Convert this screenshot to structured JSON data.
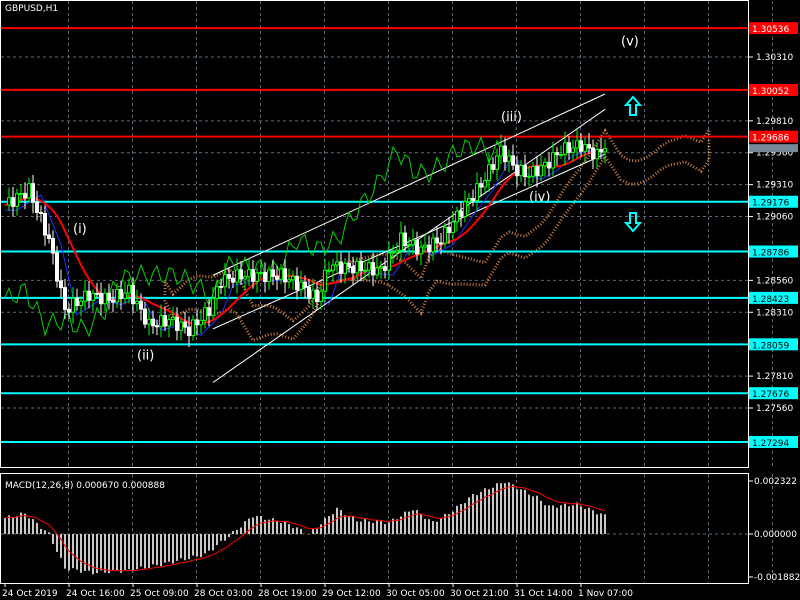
{
  "symbol_label": "GBPUSD,H1",
  "colors": {
    "bull": "#00ff00",
    "bear": "#ffffff",
    "red": "#ff0000",
    "cyan": "#00ffff",
    "grid": "#5a6a7a",
    "cloud": "#ff9a40"
  },
  "chart_data": {
    "type": "candlestick",
    "price_ticks": [
      "1.30310",
      "1.29810",
      "1.29560",
      "1.29310",
      "1.29060",
      "1.28560",
      "1.28310",
      "1.27810",
      "1.27560"
    ],
    "red_levels": [
      "1.30536",
      "1.30052",
      "1.29686"
    ],
    "cyan_levels": [
      "1.29176",
      "1.28786",
      "1.28423",
      "1.28059",
      "1.27676",
      "1.27294"
    ],
    "current_price": "1.29635",
    "price_keypoints": [
      [
        0,
        1.2915
      ],
      [
        6,
        1.2927
      ],
      [
        11,
        1.2888
      ],
      [
        15,
        1.2833
      ],
      [
        21,
        1.2845
      ],
      [
        26,
        1.2841
      ],
      [
        31,
        1.2848
      ],
      [
        36,
        1.2821
      ],
      [
        41,
        1.2825
      ],
      [
        46,
        1.2817
      ],
      [
        51,
        1.2833
      ],
      [
        54,
        1.2856
      ],
      [
        59,
        1.286
      ],
      [
        64,
        1.286
      ],
      [
        69,
        1.286
      ],
      [
        74,
        1.2852
      ],
      [
        78,
        1.2841
      ],
      [
        81,
        1.2868
      ],
      [
        85,
        1.2866
      ],
      [
        89,
        1.2866
      ],
      [
        94,
        1.2864
      ],
      [
        99,
        1.2888
      ],
      [
        104,
        1.288
      ],
      [
        109,
        1.2888
      ],
      [
        114,
        1.2911
      ],
      [
        119,
        1.2931
      ],
      [
        124,
        1.2958
      ],
      [
        128,
        1.2942
      ],
      [
        131,
        1.2939
      ],
      [
        135,
        1.2946
      ],
      [
        139,
        1.2958
      ],
      [
        144,
        1.2962
      ],
      [
        148,
        1.2954
      ],
      [
        150,
        1.2962
      ]
    ],
    "wave_labels": [
      {
        "text": "(v)",
        "bar": 156,
        "price": 1.304
      },
      {
        "text": "(iii)",
        "bar": 126,
        "price": 1.2981
      },
      {
        "text": "(iv)",
        "bar": 133,
        "price": 1.2918
      },
      {
        "text": "(i)",
        "bar": 19,
        "price": 1.2893
      },
      {
        "text": "(ii)",
        "bar": 35,
        "price": 1.2794
      }
    ],
    "time_labels": [
      "24 Oct 2019",
      "24 Oct 16:00",
      "25 Oct 09:00",
      "28 Oct 03:00",
      "28 Oct 19:00",
      "29 Oct 12:00",
      "30 Oct 05:00",
      "30 Oct 21:00",
      "31 Oct 14:00",
      "1 Nov 07:00"
    ]
  },
  "macd": {
    "label": "MACD(12,26,9) 0.000670 0.000888",
    "ticks": [
      "0.002322",
      "0.000000",
      "-0.001882"
    ],
    "keypoints": [
      [
        0,
        0.0007
      ],
      [
        5,
        0.0009
      ],
      [
        11,
        0
      ],
      [
        15,
        -0.0015
      ],
      [
        22,
        -0.0017
      ],
      [
        31,
        -0.0016
      ],
      [
        40,
        -0.0013
      ],
      [
        50,
        -0.0009
      ],
      [
        56,
        -0.0001
      ],
      [
        62,
        0.0008
      ],
      [
        70,
        0.0005
      ],
      [
        76,
        0
      ],
      [
        83,
        0.0011
      ],
      [
        88,
        0.0006
      ],
      [
        96,
        0.0005
      ],
      [
        102,
        0.0011
      ],
      [
        107,
        0.0005
      ],
      [
        111,
        0.0009
      ],
      [
        117,
        0.0017
      ],
      [
        125,
        0.0023
      ],
      [
        133,
        0.0016
      ],
      [
        136,
        0.0012
      ],
      [
        143,
        0.0013
      ],
      [
        150,
        0.0008
      ]
    ]
  }
}
